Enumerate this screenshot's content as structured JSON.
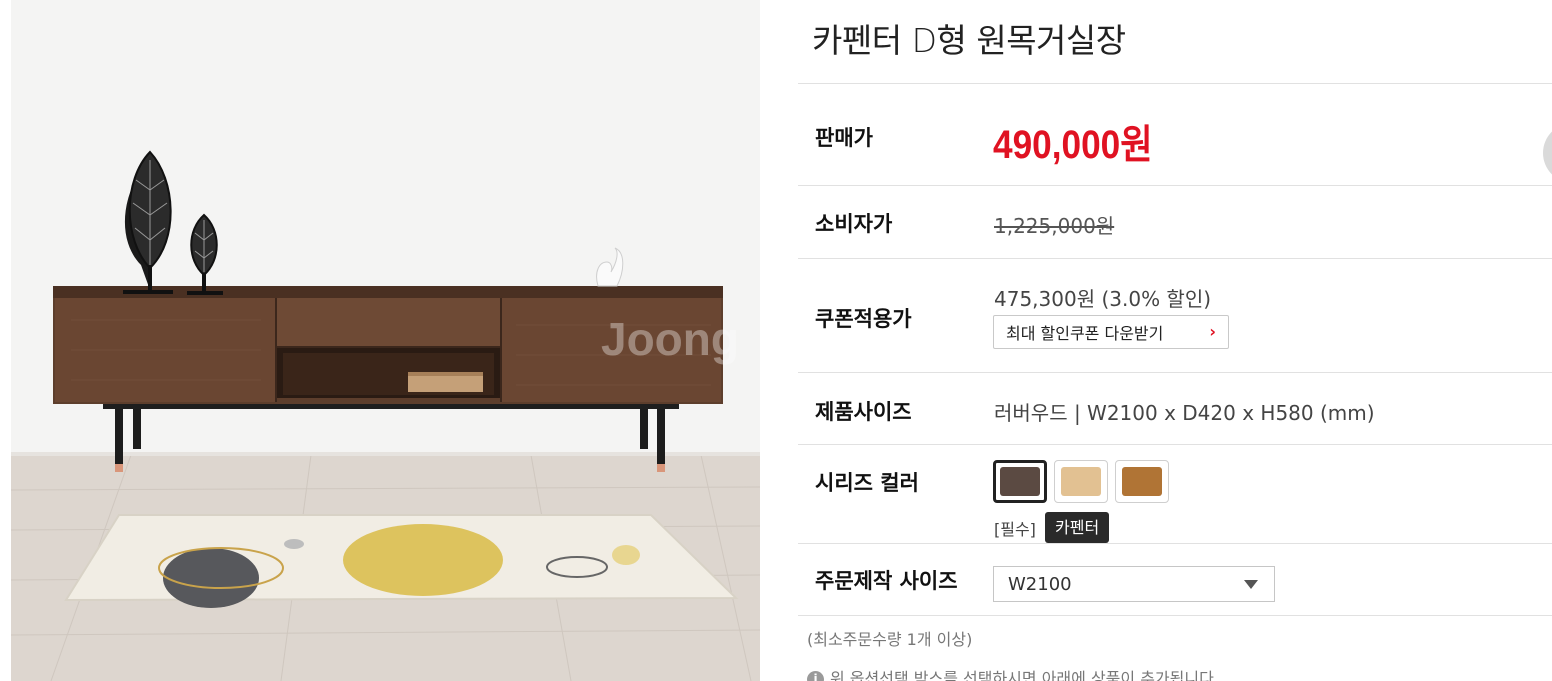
{
  "product": {
    "title": "카펜터 D형 원목거실장",
    "photo_watermark": "Joong"
  },
  "rows": {
    "sale_price": {
      "label": "판매가",
      "value": "490,000원",
      "color": "#e01222"
    },
    "consumer_price": {
      "label": "소비자가",
      "value": "1,225,000원"
    },
    "coupon_price": {
      "label": "쿠폰적용가",
      "value": "475,300원 (3.0% 할인)",
      "button_label": "최대 할인쿠폰 다운받기",
      "button_icon": "chevron-right-icon"
    },
    "size": {
      "label": "제품사이즈",
      "value": "러버우드 | W2100 x D420 x H580 (mm)"
    },
    "series_color": {
      "label": "시리즈 컬러",
      "required_label": "[필수]",
      "tooltip": "카펜터",
      "swatches": [
        {
          "color": "#5b4a42",
          "selected": true
        },
        {
          "color": "#e2c192",
          "selected": false
        },
        {
          "color": "#b07435",
          "selected": false
        }
      ]
    },
    "custom_size": {
      "label": "주문제작 사이즈",
      "selected": "W2100",
      "icon": "caret-down-icon"
    }
  },
  "min_order": "(최소주문수량 1개 이상)",
  "notice": {
    "icon": "info-icon",
    "text": "위 옵션선택 박스를 선택하시면 아래에 상품이 추가됩니다"
  }
}
